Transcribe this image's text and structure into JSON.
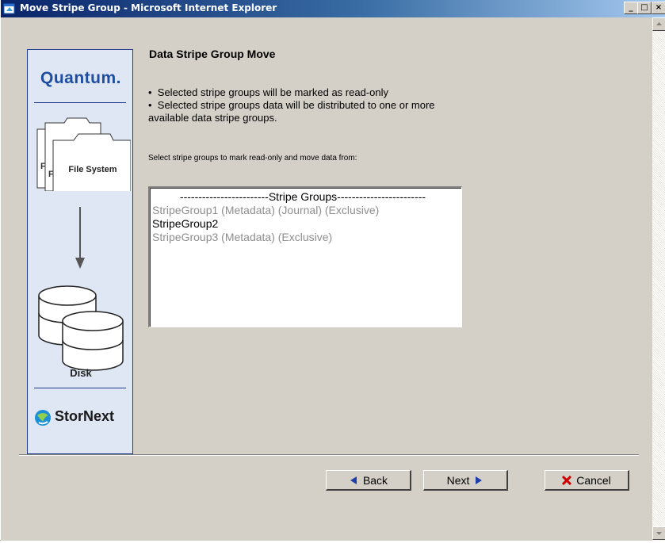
{
  "window": {
    "title": "Move Stripe Group - Microsoft Internet Explorer",
    "controls": [
      "minimize",
      "maximize",
      "close"
    ]
  },
  "sidebar": {
    "brand": "Quantum.",
    "file_system_label": "File System",
    "folder_letters": [
      "F",
      "F"
    ],
    "disk_label": "Disk",
    "product": "StorNext"
  },
  "main": {
    "heading": "Data Stripe Group Move",
    "bullets": [
      "Selected stripe groups will be marked as read-only",
      "Selected stripe groups data will be distributed to one or more",
      "available data stripe groups."
    ],
    "instruction": "Select stripe groups to mark read-only and move data from:",
    "list": {
      "header": "------------------------Stripe Groups------------------------",
      "items": [
        {
          "label": "StripeGroup1 (Metadata) (Journal) (Exclusive)",
          "enabled": false
        },
        {
          "label": "StripeGroup2",
          "enabled": true
        },
        {
          "label": "StripeGroup3 (Metadata) (Exclusive)",
          "enabled": false
        }
      ]
    }
  },
  "buttons": {
    "back": "Back",
    "next": "Next",
    "cancel": "Cancel"
  },
  "colors": {
    "title_gradient_start": "#0a246a",
    "brand_blue": "#1f4ea1",
    "arrow_blue": "#1f3fa8",
    "cancel_red": "#cc0000",
    "disabled_text": "#8e8e8e"
  },
  "icons": [
    "ie-icon",
    "file-system-icon",
    "down-arrow-icon",
    "disk-stack-icon",
    "stornext-globe-icon",
    "back-arrow-icon",
    "next-arrow-icon",
    "cancel-x-icon",
    "scroll-up-icon",
    "scroll-down-icon"
  ]
}
